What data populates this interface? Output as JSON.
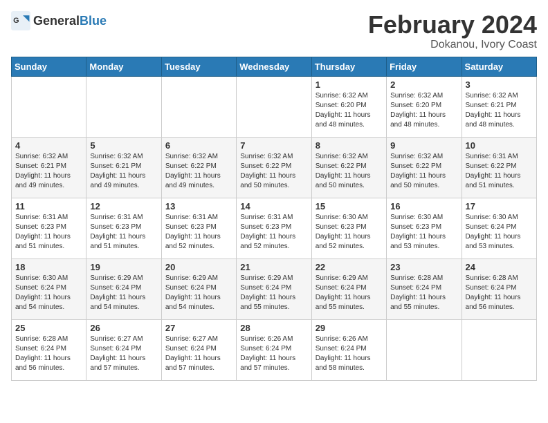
{
  "header": {
    "logo_general": "General",
    "logo_blue": "Blue",
    "month_title": "February 2024",
    "location": "Dokanou, Ivory Coast"
  },
  "days_of_week": [
    "Sunday",
    "Monday",
    "Tuesday",
    "Wednesday",
    "Thursday",
    "Friday",
    "Saturday"
  ],
  "weeks": [
    [
      {
        "day": "",
        "info": ""
      },
      {
        "day": "",
        "info": ""
      },
      {
        "day": "",
        "info": ""
      },
      {
        "day": "",
        "info": ""
      },
      {
        "day": "1",
        "info": "Sunrise: 6:32 AM\nSunset: 6:20 PM\nDaylight: 11 hours\nand 48 minutes."
      },
      {
        "day": "2",
        "info": "Sunrise: 6:32 AM\nSunset: 6:20 PM\nDaylight: 11 hours\nand 48 minutes."
      },
      {
        "day": "3",
        "info": "Sunrise: 6:32 AM\nSunset: 6:21 PM\nDaylight: 11 hours\nand 48 minutes."
      }
    ],
    [
      {
        "day": "4",
        "info": "Sunrise: 6:32 AM\nSunset: 6:21 PM\nDaylight: 11 hours\nand 49 minutes."
      },
      {
        "day": "5",
        "info": "Sunrise: 6:32 AM\nSunset: 6:21 PM\nDaylight: 11 hours\nand 49 minutes."
      },
      {
        "day": "6",
        "info": "Sunrise: 6:32 AM\nSunset: 6:22 PM\nDaylight: 11 hours\nand 49 minutes."
      },
      {
        "day": "7",
        "info": "Sunrise: 6:32 AM\nSunset: 6:22 PM\nDaylight: 11 hours\nand 50 minutes."
      },
      {
        "day": "8",
        "info": "Sunrise: 6:32 AM\nSunset: 6:22 PM\nDaylight: 11 hours\nand 50 minutes."
      },
      {
        "day": "9",
        "info": "Sunrise: 6:32 AM\nSunset: 6:22 PM\nDaylight: 11 hours\nand 50 minutes."
      },
      {
        "day": "10",
        "info": "Sunrise: 6:31 AM\nSunset: 6:22 PM\nDaylight: 11 hours\nand 51 minutes."
      }
    ],
    [
      {
        "day": "11",
        "info": "Sunrise: 6:31 AM\nSunset: 6:23 PM\nDaylight: 11 hours\nand 51 minutes."
      },
      {
        "day": "12",
        "info": "Sunrise: 6:31 AM\nSunset: 6:23 PM\nDaylight: 11 hours\nand 51 minutes."
      },
      {
        "day": "13",
        "info": "Sunrise: 6:31 AM\nSunset: 6:23 PM\nDaylight: 11 hours\nand 52 minutes."
      },
      {
        "day": "14",
        "info": "Sunrise: 6:31 AM\nSunset: 6:23 PM\nDaylight: 11 hours\nand 52 minutes."
      },
      {
        "day": "15",
        "info": "Sunrise: 6:30 AM\nSunset: 6:23 PM\nDaylight: 11 hours\nand 52 minutes."
      },
      {
        "day": "16",
        "info": "Sunrise: 6:30 AM\nSunset: 6:23 PM\nDaylight: 11 hours\nand 53 minutes."
      },
      {
        "day": "17",
        "info": "Sunrise: 6:30 AM\nSunset: 6:24 PM\nDaylight: 11 hours\nand 53 minutes."
      }
    ],
    [
      {
        "day": "18",
        "info": "Sunrise: 6:30 AM\nSunset: 6:24 PM\nDaylight: 11 hours\nand 54 minutes."
      },
      {
        "day": "19",
        "info": "Sunrise: 6:29 AM\nSunset: 6:24 PM\nDaylight: 11 hours\nand 54 minutes."
      },
      {
        "day": "20",
        "info": "Sunrise: 6:29 AM\nSunset: 6:24 PM\nDaylight: 11 hours\nand 54 minutes."
      },
      {
        "day": "21",
        "info": "Sunrise: 6:29 AM\nSunset: 6:24 PM\nDaylight: 11 hours\nand 55 minutes."
      },
      {
        "day": "22",
        "info": "Sunrise: 6:29 AM\nSunset: 6:24 PM\nDaylight: 11 hours\nand 55 minutes."
      },
      {
        "day": "23",
        "info": "Sunrise: 6:28 AM\nSunset: 6:24 PM\nDaylight: 11 hours\nand 55 minutes."
      },
      {
        "day": "24",
        "info": "Sunrise: 6:28 AM\nSunset: 6:24 PM\nDaylight: 11 hours\nand 56 minutes."
      }
    ],
    [
      {
        "day": "25",
        "info": "Sunrise: 6:28 AM\nSunset: 6:24 PM\nDaylight: 11 hours\nand 56 minutes."
      },
      {
        "day": "26",
        "info": "Sunrise: 6:27 AM\nSunset: 6:24 PM\nDaylight: 11 hours\nand 57 minutes."
      },
      {
        "day": "27",
        "info": "Sunrise: 6:27 AM\nSunset: 6:24 PM\nDaylight: 11 hours\nand 57 minutes."
      },
      {
        "day": "28",
        "info": "Sunrise: 6:26 AM\nSunset: 6:24 PM\nDaylight: 11 hours\nand 57 minutes."
      },
      {
        "day": "29",
        "info": "Sunrise: 6:26 AM\nSunset: 6:24 PM\nDaylight: 11 hours\nand 58 minutes."
      },
      {
        "day": "",
        "info": ""
      },
      {
        "day": "",
        "info": ""
      }
    ]
  ]
}
